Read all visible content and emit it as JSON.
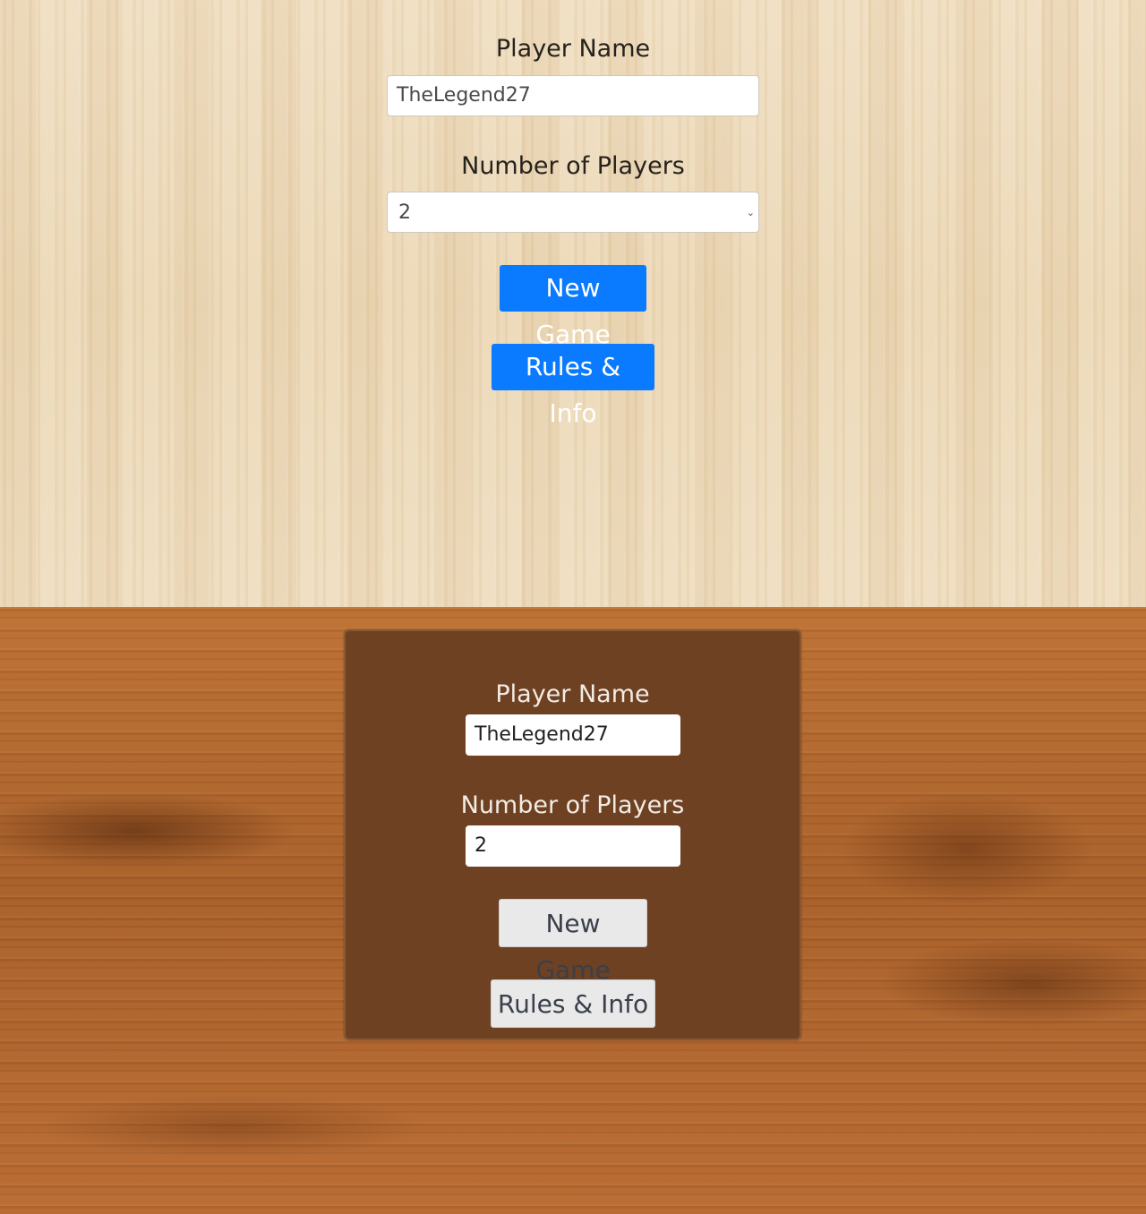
{
  "top_form": {
    "player_name_label": "Player Name",
    "player_name_value": "TheLegend27",
    "number_of_players_label": "Number of Players",
    "number_of_players_value": "2",
    "new_game_button": "New Game",
    "rules_button": "Rules & Info"
  },
  "bottom_form": {
    "player_name_label": "Player Name",
    "player_name_value": "TheLegend27",
    "number_of_players_label": "Number of Players",
    "number_of_players_value": "2",
    "new_game_button": "New Game",
    "rules_button": "Rules & Info"
  },
  "icons": {
    "select_chevron": "chevron-down-icon"
  },
  "colors": {
    "primary_button": "#0a7bff",
    "panel_background": "#6e4123",
    "secondary_button": "#e9e9e9"
  }
}
